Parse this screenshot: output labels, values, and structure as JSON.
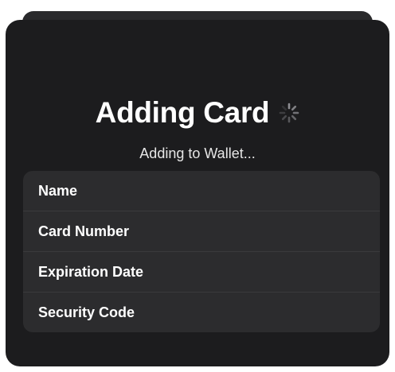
{
  "sheet": {
    "title": "Adding Card",
    "subtitle": "Adding to Wallet...",
    "spinner_icon": "activity-spinner-icon"
  },
  "fields": [
    {
      "label": "Name"
    },
    {
      "label": "Card Number"
    },
    {
      "label": "Expiration Date"
    },
    {
      "label": "Security Code"
    }
  ],
  "colors": {
    "sheet_background": "#1c1c1e",
    "list_background": "#2c2c2e",
    "text": "#ffffff"
  }
}
